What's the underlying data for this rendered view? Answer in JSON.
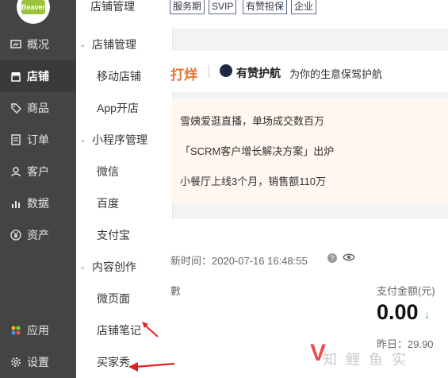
{
  "sidebar": {
    "logo_text": "Beaver",
    "items": [
      {
        "label": "概况",
        "icon": "dashboard-icon"
      },
      {
        "label": "店铺",
        "icon": "store-icon"
      },
      {
        "label": "商品",
        "icon": "tag-icon"
      },
      {
        "label": "订单",
        "icon": "order-icon"
      },
      {
        "label": "客户",
        "icon": "user-icon"
      },
      {
        "label": "数据",
        "icon": "bar-chart-icon"
      },
      {
        "label": "资产",
        "icon": "yen-icon"
      },
      {
        "label": "应用",
        "icon": "apps-icon"
      },
      {
        "label": "设置",
        "icon": "gear-icon"
      }
    ]
  },
  "subnav": {
    "title": "店铺管理",
    "groups": [
      {
        "label": "店铺管理",
        "children": [
          "移动店铺",
          "App开店"
        ]
      },
      {
        "label": "小程序管理",
        "children": [
          "微信",
          "百度",
          "支付宝"
        ]
      },
      {
        "label": "内容创作",
        "children": [
          "微页面",
          "店铺笔记",
          "买家秀"
        ]
      }
    ]
  },
  "topbar": {
    "tags": [
      "服务期",
      "SVIP",
      "有赞担保",
      "企业"
    ]
  },
  "banner": {
    "left_text": "打烊",
    "brand": "有赞护航",
    "slogan": "为你的生意保驾护航"
  },
  "promo": {
    "lines": [
      "雪姨爱逛直播，单场成交数百万",
      "「SCRM客户增长解决方案」出炉",
      "小餐厅上线3个月，销售额110万"
    ]
  },
  "stats": {
    "update_text": "新时间：2020-07-16 16:48:55",
    "count_label": "數",
    "pay_label": "支付金额(元)",
    "pay_value": "0.00",
    "yesterday": "昨日：29.90"
  },
  "watermark": "知 鲤 鱼 实"
}
